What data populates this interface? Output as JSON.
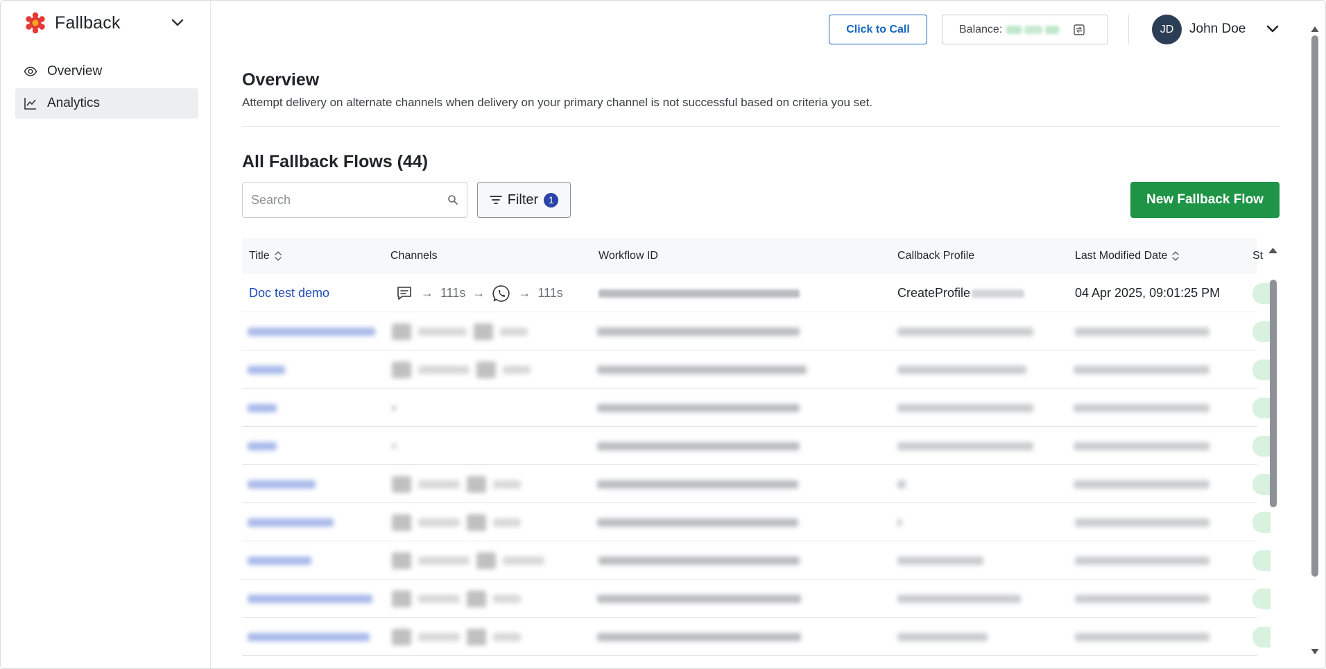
{
  "brand": {
    "name": "Fallback",
    "logo_icon": "fallback-logo-icon"
  },
  "nav": {
    "items": [
      {
        "label": "Overview",
        "icon": "eye-icon",
        "active": false
      },
      {
        "label": "Analytics",
        "icon": "chart-line-icon",
        "active": true
      }
    ]
  },
  "topbar": {
    "call_label": "Click to Call",
    "balance_label": "Balance:",
    "user_initials": "JD",
    "user_name": "John Doe"
  },
  "page": {
    "title": "Overview",
    "description": "Attempt delivery on alternate channels when delivery on your primary channel is not successful based on criteria you set."
  },
  "flows": {
    "heading": "All Fallback Flows (44)",
    "search_placeholder": "Search",
    "filter_label": "Filter",
    "filter_count": "1",
    "new_label": "New Fallback Flow",
    "columns": [
      "Title",
      "Channels",
      "Workflow ID",
      "Callback Profile",
      "Last Modified Date",
      "St"
    ],
    "first_row": {
      "title": "Doc test demo",
      "channel_1_delay": "111s",
      "channel_2_delay": "111s",
      "callback_profile": "CreateProfile",
      "last_modified": "04 Apr 2025, 09:01:25 PM"
    }
  },
  "colors": {
    "accent_blue": "#1565c0",
    "link_blue": "#1e4bb8",
    "primary_green": "#1e9447",
    "status_green": "#d8f2df",
    "brand_red": "#e53935"
  }
}
